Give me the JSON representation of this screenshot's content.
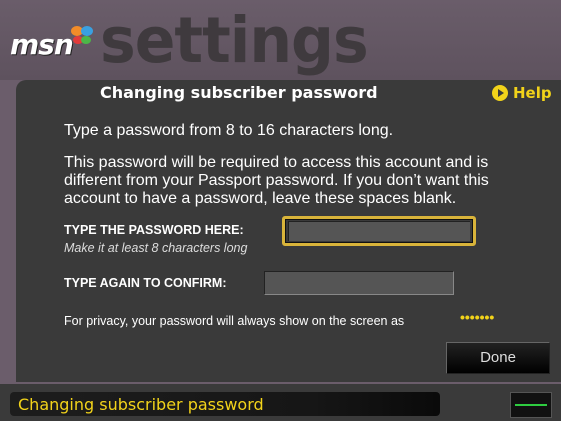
{
  "brand": {
    "logo_text": "msn",
    "section_title": "settings"
  },
  "panel": {
    "title": "Changing subscriber password",
    "help_label": "Help",
    "paragraph1": "Type a password from 8 to 16 characters long.",
    "paragraph2": "This password will be required to access this account and is different from your Passport password. If you don’t want this account to have a password, leave these spaces blank.",
    "password_label": "TYPE THE PASSWORD HERE:",
    "password_hint": "Make it at least 8 characters long",
    "confirm_label": "TYPE AGAIN TO CONFIRM:",
    "privacy_note": "For privacy, your password will always show on the screen as",
    "privacy_dots": "•••••••",
    "done_label": "Done"
  },
  "statusbar": {
    "text": "Changing subscriber password"
  },
  "colors": {
    "accent": "#f2d31a",
    "panel_bg": "#3a3a3a",
    "header_bg": "#6b5d6b"
  }
}
